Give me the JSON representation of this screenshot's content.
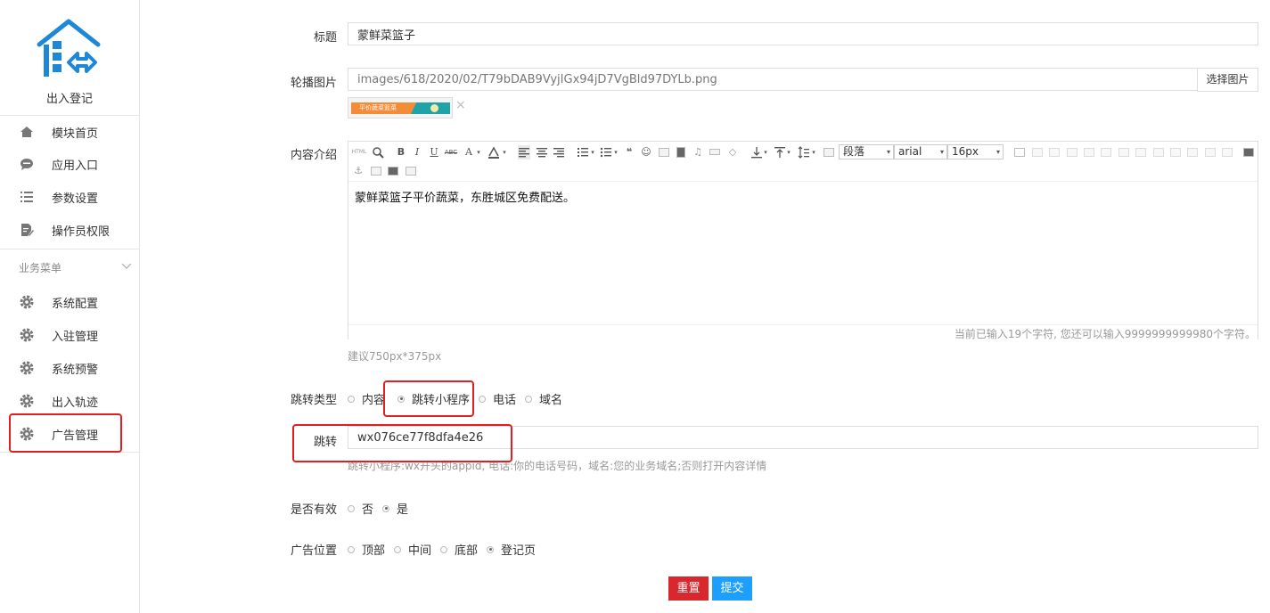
{
  "sidebar": {
    "brand": "出入登记",
    "top_items": [
      {
        "label": "模块首页",
        "icon": "home-icon"
      },
      {
        "label": "应用入口",
        "icon": "chat-bubble-icon"
      },
      {
        "label": "参数设置",
        "icon": "list-icon"
      },
      {
        "label": "操作员权限",
        "icon": "document-edit-icon"
      }
    ],
    "section_title": "业务菜单",
    "business_items": [
      {
        "label": "系统配置",
        "icon": "gear-icon"
      },
      {
        "label": "入驻管理",
        "icon": "gear-icon"
      },
      {
        "label": "系统预警",
        "icon": "gear-icon"
      },
      {
        "label": "出入轨迹",
        "icon": "gear-icon"
      },
      {
        "label": "广告管理",
        "icon": "gear-icon",
        "highlighted": true
      }
    ]
  },
  "form": {
    "title": {
      "label": "标题",
      "value": "蒙鲜菜篮子"
    },
    "carousel": {
      "label": "轮播图片",
      "value": "images/618/2020/02/T79bDAB9VyjIGx94jD7VgBld97DYLb.png",
      "button": "选择图片",
      "thumbnail_text": "平价蔬菜篮菜",
      "remove": "×"
    },
    "content": {
      "label": "内容介绍",
      "text": "蒙鲜菜篮子平价蔬菜，东胜城区免费配送。",
      "counter": "当前已输入19个字符, 您还可以输入9999999999980个字符。",
      "hint": "建议750px*375px",
      "toolbar": {
        "html": "HTML",
        "bold": "B",
        "italic": "I",
        "underline": "U",
        "strike": "ABC",
        "font_color": "A",
        "paragraph": "段落",
        "font": "arial",
        "size": "16px",
        "quote": "❝",
        "emoji": "☺",
        "anchor": "⚓"
      }
    },
    "jump_type": {
      "label": "跳转类型",
      "options": [
        "内容",
        "跳转小程序",
        "电话",
        "域名"
      ],
      "selected": 1
    },
    "jump": {
      "label": "跳转",
      "value": "wx076ce77f8dfa4e26",
      "hint": "跳转小程序:wx开头的appid, 电话:你的电话号码，域名:您的业务域名;否则打开内容详情"
    },
    "valid": {
      "label": "是否有效",
      "options": [
        "否",
        "是"
      ],
      "selected": 1
    },
    "position": {
      "label": "广告位置",
      "options": [
        "顶部",
        "中间",
        "底部",
        "登记页"
      ],
      "selected": 3
    },
    "buttons": {
      "reset": "重置",
      "submit": "提交"
    }
  },
  "colors": {
    "accent": "#1e9fff",
    "danger": "#d9272e",
    "logo": "#1e88d8",
    "highlight": "#e02020"
  }
}
